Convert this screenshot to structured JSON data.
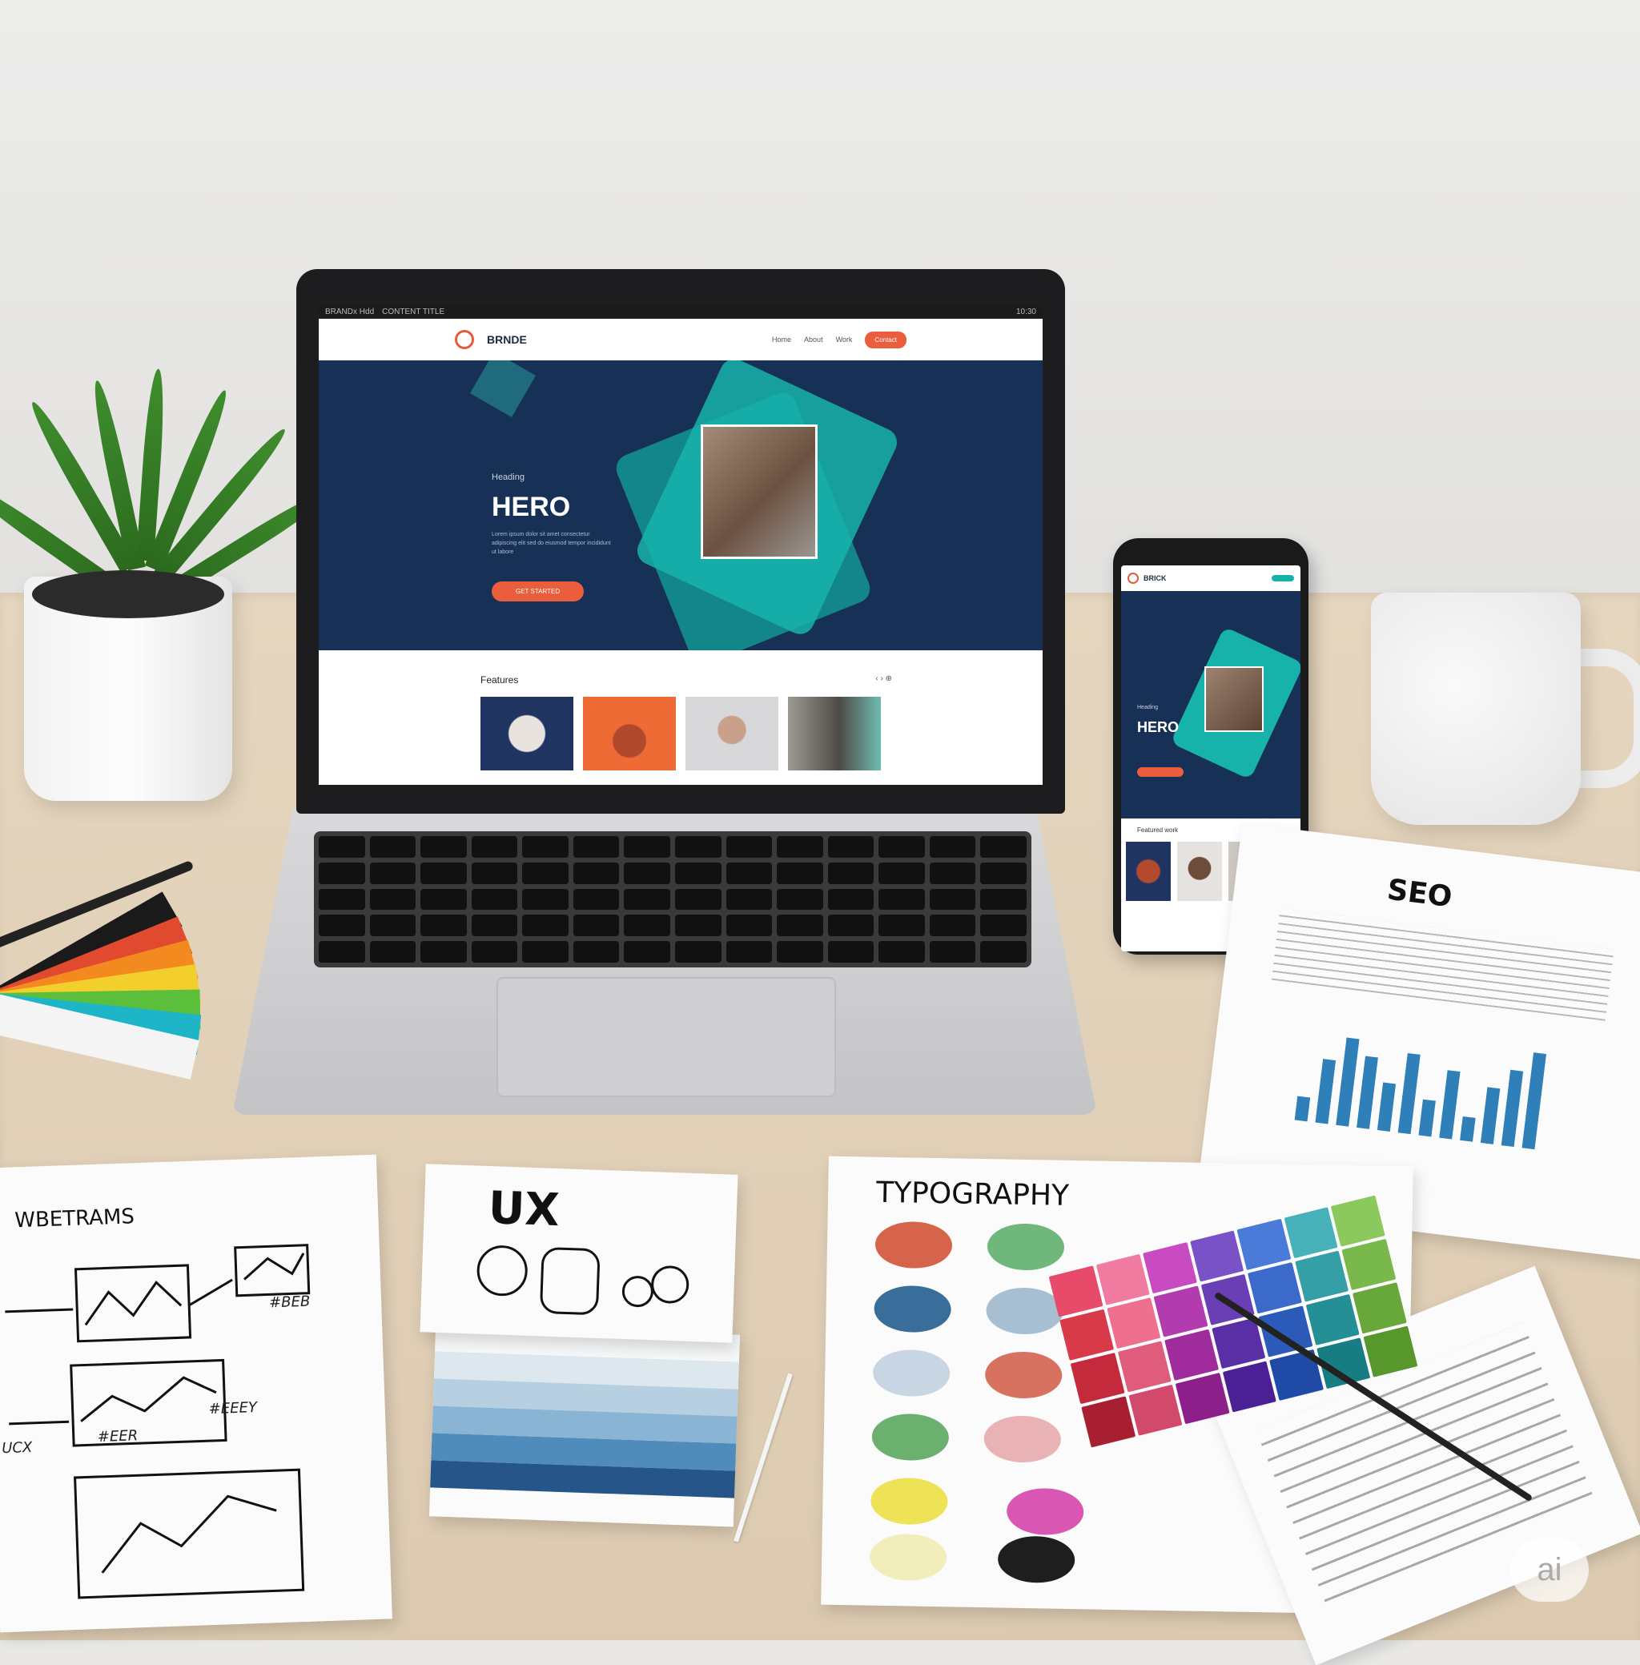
{
  "laptop_site": {
    "status_bar": [
      "BRANDx  Hdd",
      "CONTENT TITLE",
      "10:30"
    ],
    "brand": "BRNDE",
    "nav_links": [
      "Home",
      "About",
      "Work"
    ],
    "nav_button": "Contact",
    "hero_eyebrow": "Heading",
    "hero_title": "HERO",
    "hero_body": "Lorem ipsum dolor sit amet consectetur adipiscing elit sed do eiusmod tempor incididunt ut labore",
    "hero_button": "GET STARTED",
    "features_title": "Features",
    "features_controls": "‹  ›  ⊕"
  },
  "phone_site": {
    "brand": "BRICK",
    "hero_eyebrow": "Heading",
    "hero_title": "HERO",
    "features_title": "Featured work"
  },
  "papers": {
    "wireframes_title": "WBETRAMS",
    "wireframe_notes": [
      "#BEB",
      "UCX",
      "#EER",
      "#EEEY"
    ],
    "ux_title": "UX",
    "typography_title": "TYPOGRAPHY",
    "seo_title": "SEO"
  },
  "watermark": "ai",
  "colors": {
    "navy": "#173055",
    "teal": "#17b3ab",
    "accent": "#ea5d3d"
  }
}
